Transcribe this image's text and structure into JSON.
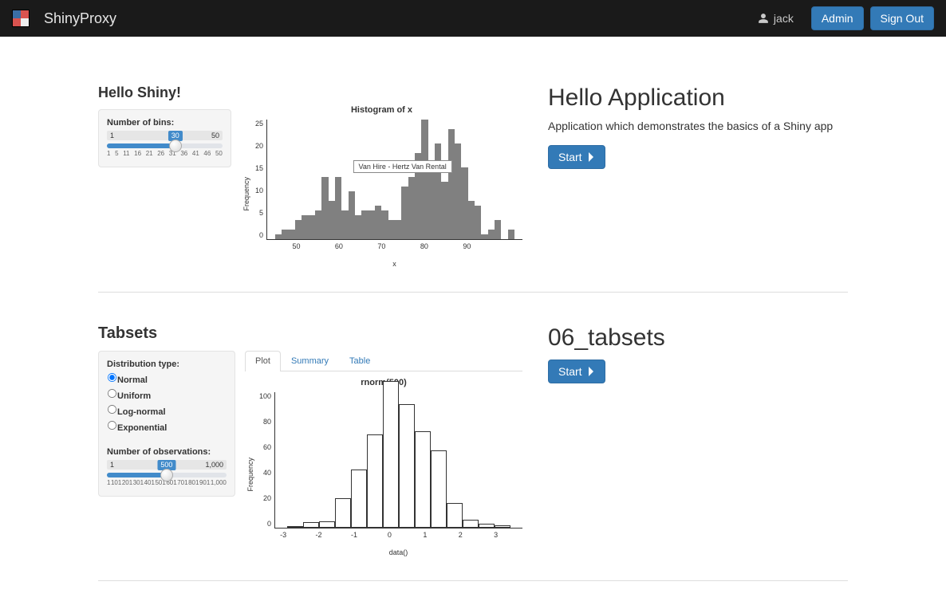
{
  "navbar": {
    "brand": "ShinyProxy",
    "username": "jack",
    "admin_label": "Admin",
    "signout_label": "Sign Out"
  },
  "apps": [
    {
      "meta": {
        "title": "Hello Application",
        "desc": "Application which demonstrates the basics of a Shiny app",
        "start_label": "Start"
      },
      "thumb": {
        "heading": "Hello Shiny!",
        "slider": {
          "label": "Number of bins:",
          "min": "1",
          "max": "50",
          "value": "30",
          "ticks": [
            "1",
            "5",
            "11",
            "16",
            "21",
            "26",
            "31",
            "36",
            "41",
            "46",
            "50"
          ]
        },
        "tooltip_text": "Van Hire - Hertz Van Rental"
      }
    },
    {
      "meta": {
        "title": "06_tabsets",
        "desc": "",
        "start_label": "Start"
      },
      "thumb": {
        "heading": "Tabsets",
        "radios": {
          "label": "Distribution type:",
          "options": [
            "Normal",
            "Uniform",
            "Log-normal",
            "Exponential"
          ],
          "selected": 0
        },
        "slider": {
          "label": "Number of observations:",
          "min": "1",
          "max": "1,000",
          "value": "500",
          "ticks": [
            "1",
            "101",
            "201",
            "301",
            "401",
            "501",
            "601",
            "701",
            "801",
            "901",
            "1,000"
          ]
        },
        "tabs": {
          "items": [
            "Plot",
            "Summary",
            "Table"
          ],
          "active": 0
        }
      }
    }
  ],
  "chart_data": [
    {
      "type": "bar",
      "title": "Histogram of x",
      "xlabel": "x",
      "ylabel": "Frequency",
      "ylim": [
        0,
        25
      ],
      "yticks": [
        0,
        5,
        10,
        15,
        20,
        25
      ],
      "xticks": [
        50,
        60,
        70,
        80,
        90
      ],
      "bin_start": 43,
      "bin_width": 1.667,
      "values": [
        1,
        2,
        2,
        4,
        5,
        5,
        6,
        13,
        8,
        13,
        6,
        10,
        5,
        6,
        6,
        7,
        6,
        4,
        4,
        11,
        13,
        18,
        25,
        14,
        20,
        12,
        23,
        20,
        15,
        8,
        7,
        1,
        2,
        4,
        0,
        2
      ]
    },
    {
      "type": "bar",
      "title": "rnorm(500)",
      "xlabel": "data()",
      "ylabel": "Frequency",
      "ylim": [
        0,
        100
      ],
      "yticks": [
        0,
        20,
        40,
        60,
        80,
        100
      ],
      "xticks": [
        -3,
        -2,
        -1,
        0,
        1,
        2,
        3
      ],
      "bin_start": -3.25,
      "bin_width": 0.5,
      "values": [
        1,
        4,
        5,
        22,
        43,
        69,
        108,
        91,
        71,
        57,
        18,
        6,
        3,
        2
      ]
    }
  ]
}
